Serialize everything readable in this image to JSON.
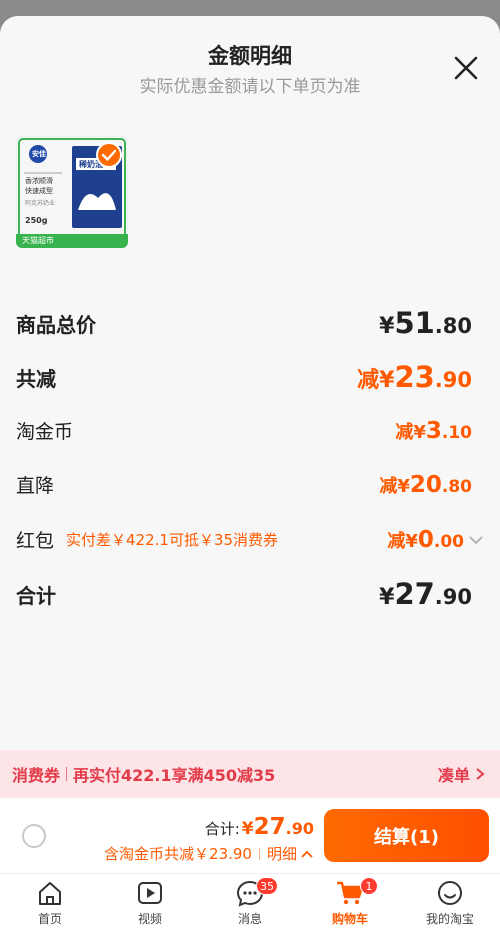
{
  "sheet": {
    "title": "金额明细",
    "subtitle": "实际优惠金额请以下单页为准"
  },
  "product": {
    "brand_text": "安佳",
    "pack_name": "稀奶油",
    "lines": [
      "香浓顺滑",
      "快速成型"
    ],
    "small_text": "阿克苏奶业",
    "weight": "250g",
    "store_badge": "天猫超市",
    "selected": true
  },
  "rows": {
    "goods_total": {
      "label": "商品总价",
      "yen": "¥",
      "int": "51",
      "dec": ".80"
    },
    "total_reduce": {
      "label": "共减",
      "prefix": "减",
      "yen": "¥",
      "int": "23",
      "dec": ".90"
    },
    "coin": {
      "label": "淘金币",
      "prefix": "减",
      "yen": "¥",
      "int": "3",
      "dec": ".10"
    },
    "direct": {
      "label": "直降",
      "prefix": "减",
      "yen": "¥",
      "int": "20",
      "dec": ".80"
    },
    "red_packet": {
      "label": "红包",
      "hint": "实付差￥422.1可抵￥35消费券",
      "prefix": "减",
      "yen": "¥",
      "int": "0",
      "dec": ".00"
    },
    "total": {
      "label": "合计",
      "yen": "¥",
      "int": "27",
      "dec": ".90"
    }
  },
  "promo": {
    "tag": "消费券",
    "text": "再实付422.1享满450减35",
    "action": "凑单"
  },
  "footer": {
    "sum_label": "合计:",
    "sum_yen": "¥",
    "sum_int": "27",
    "sum_dec": ".90",
    "sub_text": "含淘金币共减￥23.90",
    "detail_label": "明细",
    "checkout_label": "结算(1)"
  },
  "tabs": [
    {
      "label": "首页",
      "icon": "home-icon"
    },
    {
      "label": "视频",
      "icon": "video-icon"
    },
    {
      "label": "消息",
      "icon": "message-icon",
      "badge": "35"
    },
    {
      "label": "购物车",
      "icon": "cart-icon",
      "badge": "1",
      "active": true
    },
    {
      "label": "我的淘宝",
      "icon": "profile-icon"
    }
  ],
  "colors": {
    "accent": "#ff5a00",
    "promo_text": "#e23b4a",
    "promo_bg": "#fde5e7"
  }
}
